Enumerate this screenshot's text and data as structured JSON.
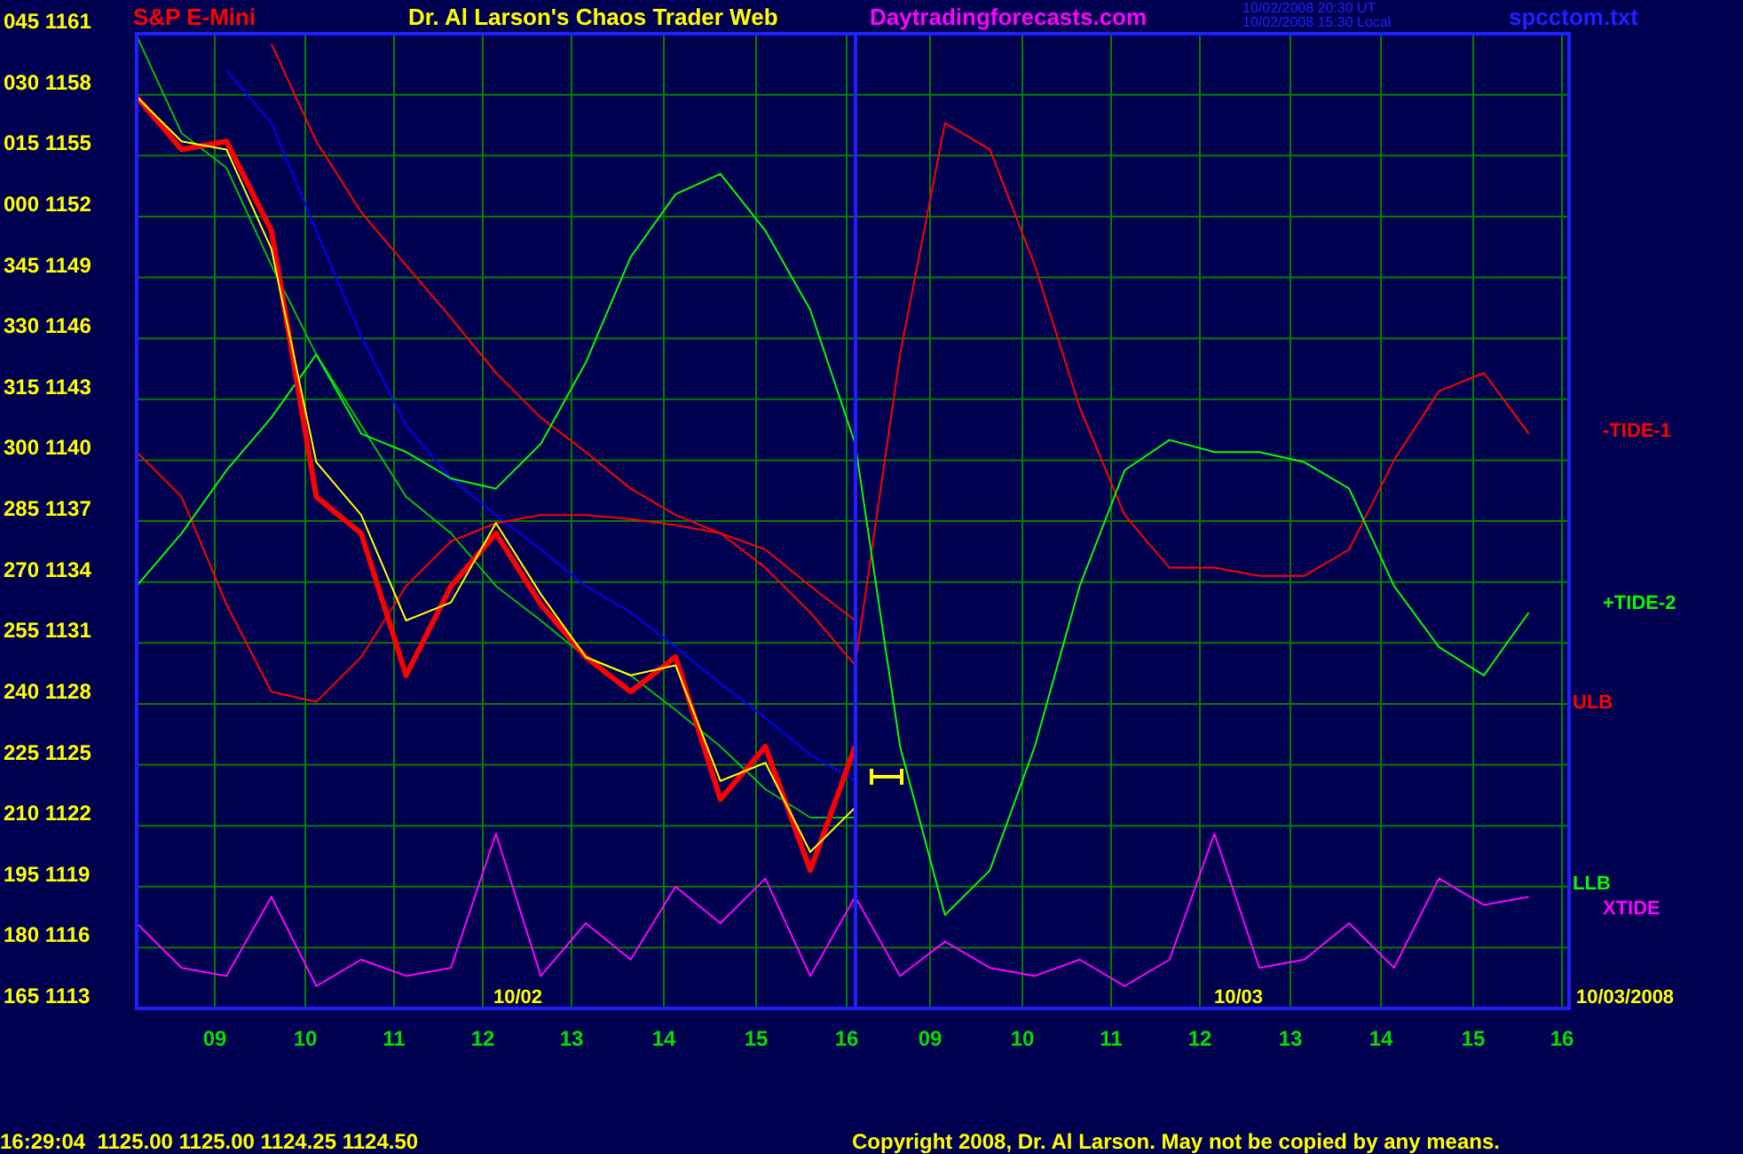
{
  "header": {
    "symbol": "S&P E-Mini",
    "title": "Dr. Al Larson's Chaos Trader Web",
    "site": "Daytradingforecasts.com",
    "timestamps": [
      "10/02/2008 20:30 UT",
      "10/02/2008 15:30 Local"
    ],
    "file": "spcctom.txt"
  },
  "chart": {
    "y_axis_labels": [
      "045 1161",
      "030 1158",
      "015 1155",
      "000 1152",
      "345 1149",
      "330 1146",
      "315 1143",
      "300 1140",
      "285 1137",
      "270 1134",
      "255 1131",
      "240 1128",
      "225 1125",
      "210 1122",
      "195 1119",
      "180 1116",
      "165 1113"
    ],
    "x_axis_labels": [
      "09",
      "10",
      "11",
      "12",
      "13",
      "14",
      "15",
      "16",
      "09",
      "10",
      "11",
      "12",
      "13",
      "14",
      "15",
      "16"
    ],
    "line_labels": [
      {
        "text": "-TIDE-1",
        "color": "#ff0000"
      },
      {
        "text": "+TIDE-2",
        "color": "#00ff00"
      },
      {
        "text": "ULB",
        "color": "#ff0000"
      },
      {
        "text": "LLB",
        "color": "#00ff00"
      },
      {
        "text": "XTIDE",
        "color": "#ff00ff"
      }
    ],
    "date_labels": [
      "10/02",
      "10/03",
      "10/03/2008"
    ]
  },
  "status_bar": {
    "quote": "16:29:04  1125.00 1125.00 1124.25 1124.50",
    "copyright": "Copyright 2008, Dr. Al Larson. May not be copied by any means."
  }
}
